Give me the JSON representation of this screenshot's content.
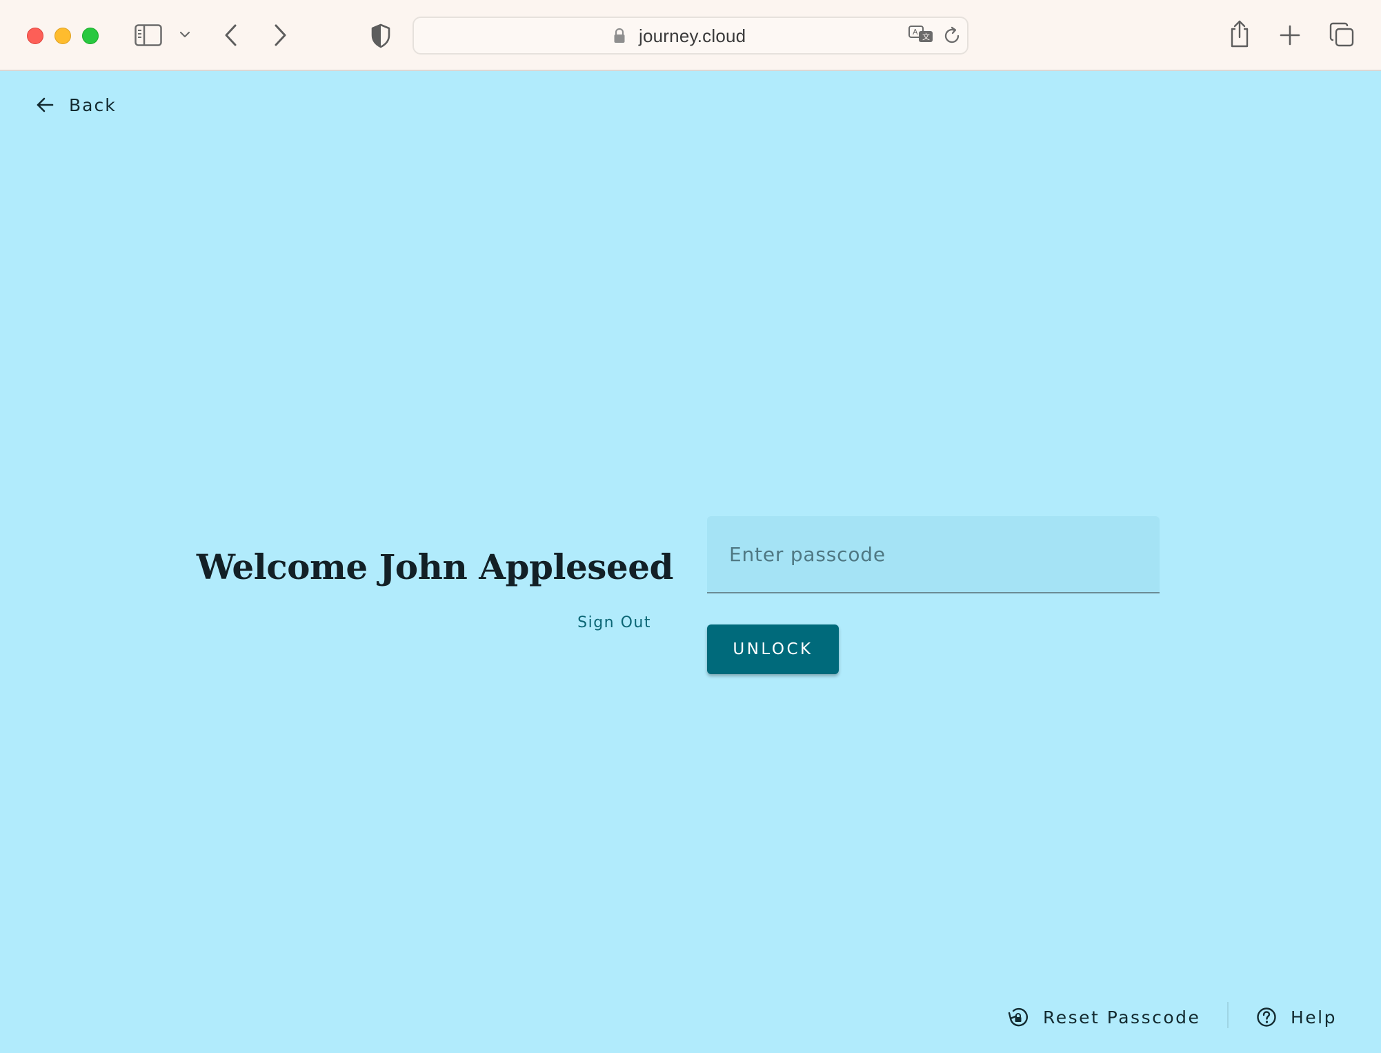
{
  "browser": {
    "url": "journey.cloud",
    "icons": [
      "sidebar-icon",
      "chevron-down-icon",
      "back-arrow-icon",
      "forward-arrow-icon",
      "shield-icon",
      "lock-icon",
      "translate-icon",
      "reload-icon",
      "share-icon",
      "plus-icon",
      "tabs-icon"
    ]
  },
  "page": {
    "back_label": "Back",
    "welcome_title": "Welcome John Appleseed",
    "sign_out_label": "Sign Out",
    "passcode_placeholder": "Enter passcode",
    "passcode_value": "",
    "unlock_label": "UNLOCK",
    "footer": {
      "reset_label": "Reset Passcode",
      "help_label": "Help"
    }
  },
  "colors": {
    "page_background": "#b1ebfc",
    "accent": "#006a7b",
    "link": "#0b6675",
    "toolbar": "#fcf5f0"
  }
}
